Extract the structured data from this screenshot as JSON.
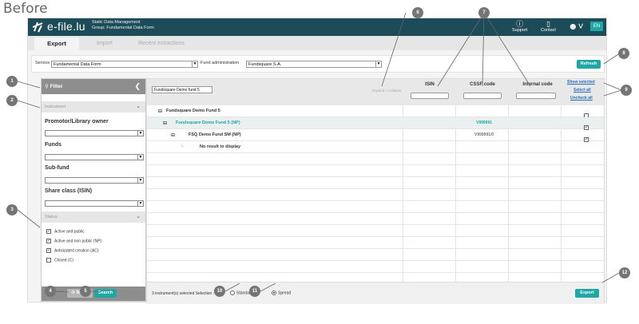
{
  "caption": "Before",
  "app": {
    "logo_text": "e-file.lu",
    "logo_sub_line1": "Static Data Management",
    "logo_sub_line2": "Group: Fundamental Data Form",
    "support_label": "Support",
    "contact_label": "Contact",
    "lang": "EN"
  },
  "tabs": [
    {
      "label": "Export",
      "active": true
    },
    {
      "label": "Import",
      "active": false
    },
    {
      "label": "Recent extractions",
      "active": false
    }
  ],
  "service": {
    "service_label": "Service",
    "service_value": "Fundamental Data Form",
    "fund_admin_label": "Fund administration",
    "fund_admin_value": "Fundsquare S.A.",
    "refresh_label": "Refresh"
  },
  "filter": {
    "title": "Filter",
    "instrument_label": "Instrument",
    "promotor_label": "Promotor/Library owner",
    "funds_label": "Funds",
    "subfund_label": "Sub-fund",
    "shareclass_label": "Share class (ISIN)",
    "status_label": "Status",
    "status_items": [
      {
        "label": "Active and public",
        "checked": true
      },
      {
        "label": "Active and non public (NP)",
        "checked": true
      },
      {
        "label": "Anticipated creation (AC)",
        "checked": true
      },
      {
        "label": "Closed (C)",
        "checked": false
      }
    ],
    "reset_label": "Reset",
    "search_label": "Search"
  },
  "grid": {
    "search_value": "Fundsquare Demo fund 5",
    "expand_label": "Expand / Collapse",
    "columns": {
      "isin": "ISIN",
      "cssf": "CSSF code",
      "internal": "Internal code"
    },
    "actions": {
      "show_selected": "Show selected",
      "select_all": "Select all",
      "uncheck_all": "Uncheck all"
    },
    "rows": [
      {
        "name": "Fundsquare Demo Fund 5",
        "cssf": "",
        "checked": false,
        "highlight": false,
        "color": "#333333"
      },
      {
        "name": "Fundsquare Demo Fund 5 (NP)",
        "cssf": "V999991",
        "checked": true,
        "highlight": true,
        "color": "#1fa7a6"
      },
      {
        "name": "FSQ Demo Fund SM (NP)",
        "cssf": "V999991/0",
        "checked": true,
        "highlight": false,
        "color": "#333333"
      },
      {
        "name": "No result to display",
        "cssf": "",
        "checked": null,
        "highlight": false,
        "color": "#333333"
      }
    ],
    "footer_text": "3 instrument(s) selected   Selection :",
    "selection_options": [
      {
        "label": "Standard",
        "selected": false
      },
      {
        "label": "Spread",
        "selected": true
      }
    ],
    "export_label": "Export"
  },
  "callouts": [
    "1",
    "2",
    "3",
    "4",
    "5",
    "6",
    "7",
    "8",
    "9",
    "10",
    "11",
    "12"
  ],
  "colors": {
    "header": "#1d4b57",
    "accent": "#1fa7a6",
    "callout": "#757575"
  }
}
